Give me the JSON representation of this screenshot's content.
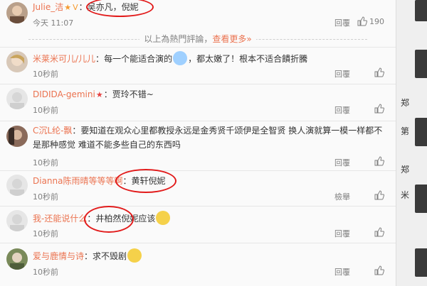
{
  "comments": [
    {
      "user": "Julie_洁",
      "badge": true,
      "text": "吴亦凡，倪妮",
      "time": "今天 11:07",
      "reply": "回覆",
      "likes": "190"
    },
    {
      "user": "米莱米可儿/儿儿",
      "badge": false,
      "text_before": "每一个能适合演的",
      "text_after": "，都太嫩了！根本不适合饋折騰",
      "time": "10秒前",
      "reply": "回覆",
      "likes": ""
    },
    {
      "user": "DIDIDA-gemini",
      "badge": true,
      "text": "贾玲不错~",
      "time": "10秒前",
      "reply": "回覆",
      "likes": ""
    },
    {
      "user": "C沉L纶-飘",
      "badge": false,
      "text": "要知道在观众心里都教授永远是金秀贤千颂伊是全智贤 换人演就算一模一样都不是那种感觉 难道不能多些自己的东西吗",
      "time": "10秒前",
      "reply": "回覆",
      "likes": ""
    },
    {
      "user": "Dianna陈雨晴等等等啊",
      "badge": false,
      "text": "黄轩倪妮",
      "time": "10秒前",
      "reply": "檢舉",
      "likes": ""
    },
    {
      "user": "我-还能说什么",
      "badge": false,
      "text": "井柏然倪妮",
      "text_after": "应该",
      "time": "10秒前",
      "reply": "回覆",
      "likes": ""
    },
    {
      "user": "爱与鹿情与诗",
      "badge": false,
      "text": "求不毁剧",
      "time": "10秒前",
      "reply": "回覆",
      "likes": ""
    }
  ],
  "more": {
    "prefix": "以上為熱門評論，",
    "link": "查看更多»"
  },
  "colors": {
    "username": "#eb7350",
    "highlight_circle": "#e21b1b",
    "badge": "#f59b30"
  },
  "icons": {
    "like": "thumbs-up-icon",
    "badge": "verified-v-icon",
    "emoji_shy": "blushing-emoji-icon",
    "emoji_think": "thinking-emoji-icon",
    "emoji_cry": "crying-emoji-icon"
  },
  "right_strip": {
    "chars": [
      "郑",
      "第",
      "郑",
      "米"
    ]
  }
}
